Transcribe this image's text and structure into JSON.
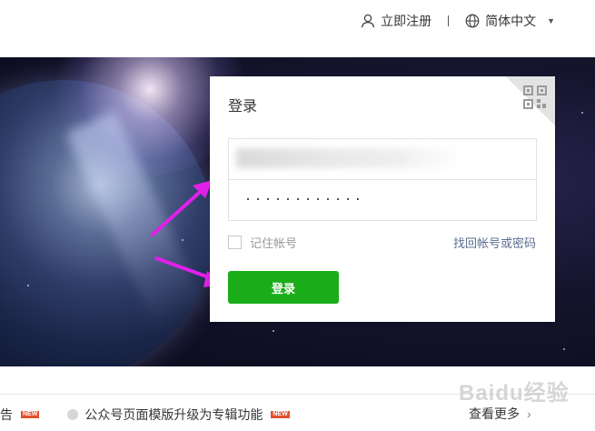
{
  "header": {
    "register_label": "立即注册",
    "language_label": "简体中文"
  },
  "login_card": {
    "title": "登录",
    "account_value": "",
    "password_dots": "············",
    "remember_label": "记住帐号",
    "forgot_label": "找回帐号或密码",
    "login_button": "登录"
  },
  "notices": {
    "item1": "告",
    "item2": "公众号页面模版升级为专辑功能",
    "new_badge": "NEW",
    "more_label": "查看更多"
  },
  "watermark": "Baidu经验",
  "colors": {
    "accent_green": "#1aad19",
    "link_blue": "#5a6e91",
    "arrow_magenta": "#e020e8",
    "new_badge": "#e2512c"
  }
}
